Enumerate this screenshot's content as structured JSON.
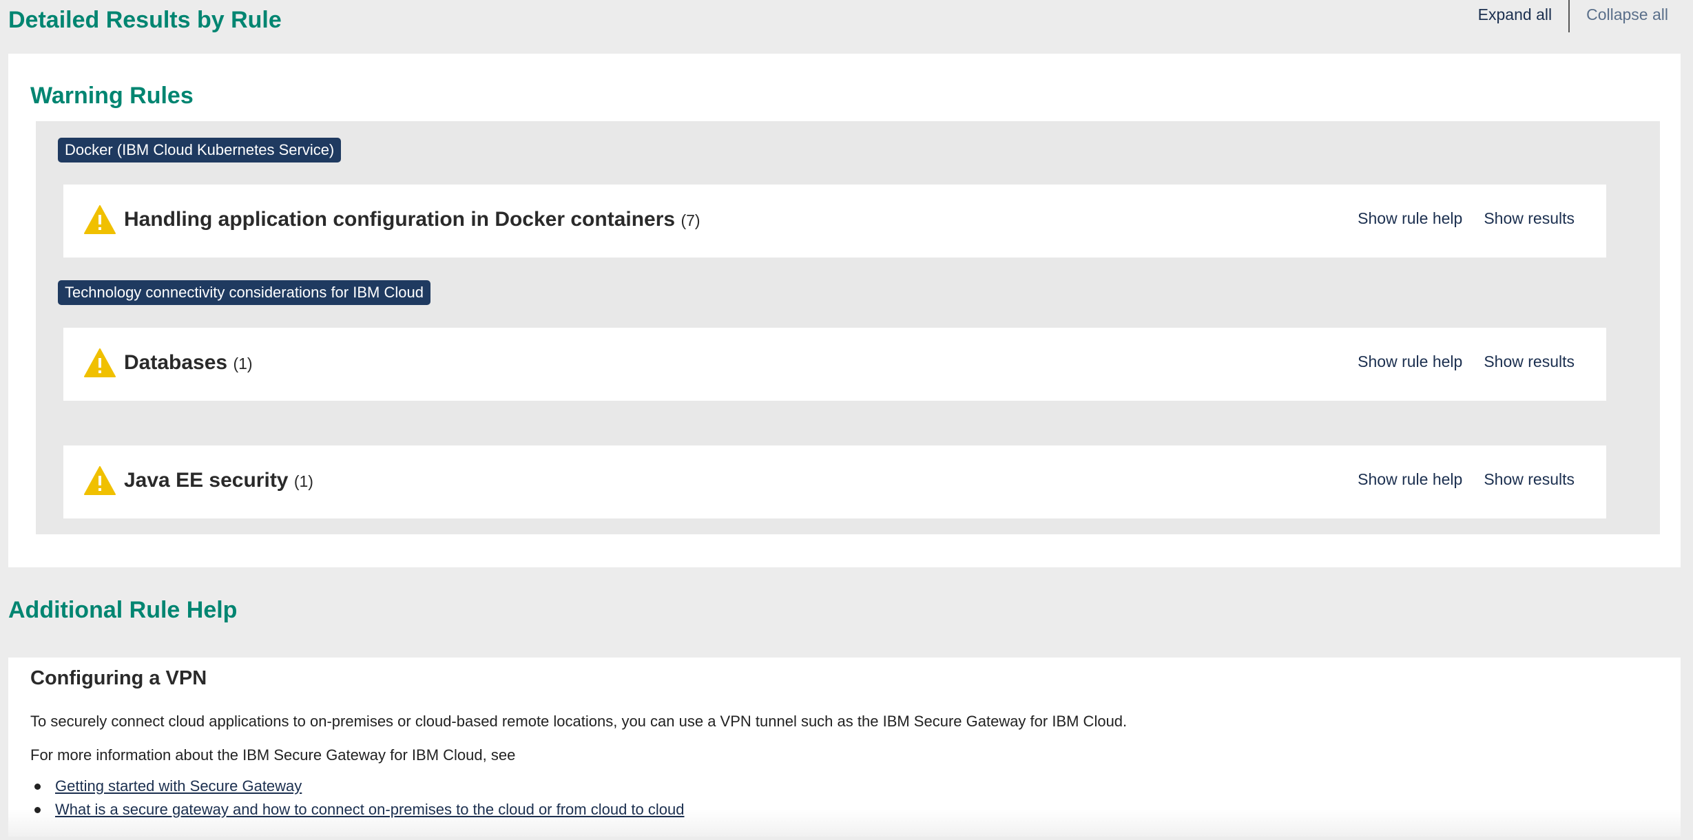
{
  "header": {
    "title": "Detailed Results by Rule",
    "expand_label": "Expand all",
    "collapse_label": "Collapse all"
  },
  "warning_section": {
    "title": "Warning Rules",
    "categories": [
      {
        "label": "Docker (IBM Cloud Kubernetes Service)"
      },
      {
        "label": "Technology connectivity considerations for IBM Cloud"
      }
    ],
    "rules": [
      {
        "icon": "warning-icon",
        "title": "Handling application configuration in Docker containers",
        "count": "(7)",
        "help_label": "Show rule help",
        "results_label": "Show results"
      },
      {
        "icon": "warning-icon",
        "title": "Databases",
        "count": "(1)",
        "help_label": "Show rule help",
        "results_label": "Show results"
      },
      {
        "icon": "warning-icon",
        "title": "Java EE security",
        "count": "(1)",
        "help_label": "Show rule help",
        "results_label": "Show results"
      }
    ]
  },
  "additional_help": {
    "title": "Additional Rule Help",
    "heading": "Configuring a VPN",
    "paragraph1": "To securely connect cloud applications to on-premises or cloud-based remote locations, you can use a VPN tunnel such as the IBM Secure Gateway for IBM Cloud.",
    "paragraph2": "For more information about the IBM Secure Gateway for IBM Cloud, see",
    "links": [
      " Getting started with Secure Gateway",
      " What is a secure gateway and how to connect on-premises to the cloud or from cloud to cloud"
    ]
  },
  "colors": {
    "accent": "#008571",
    "tag_bg": "#1f3a60",
    "warning": "#f0c000",
    "link": "#1b2f4f"
  }
}
